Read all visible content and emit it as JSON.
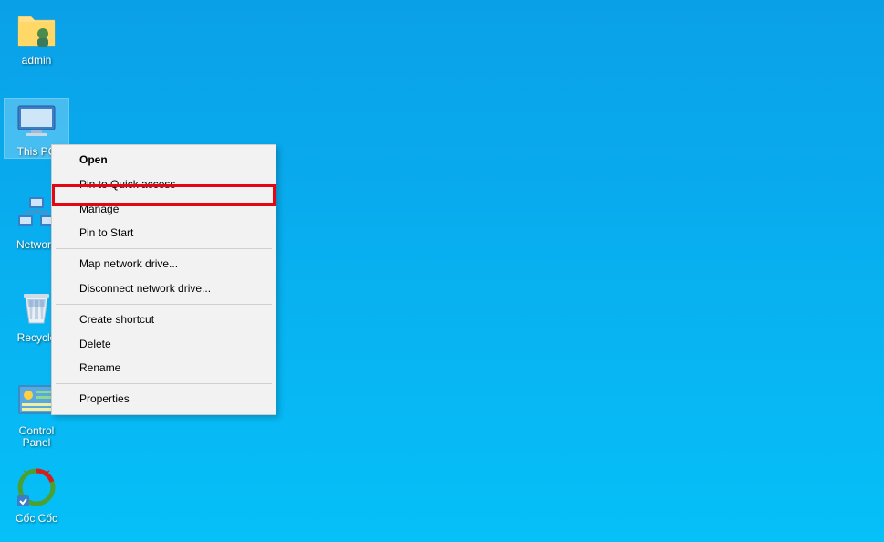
{
  "desktop_icons": [
    {
      "id": "admin",
      "label": "admin"
    },
    {
      "id": "this_pc",
      "label": "This PC"
    },
    {
      "id": "network",
      "label": "Network"
    },
    {
      "id": "recycle",
      "label": "Recycle"
    },
    {
      "id": "control_panel",
      "label": "Control Panel"
    },
    {
      "id": "coc_coc",
      "label": "Cốc Cốc"
    }
  ],
  "context_menu": {
    "open": "Open",
    "pin_quick": "Pin to Quick access",
    "manage": "Manage",
    "pin_start": "Pin to Start",
    "map_drive": "Map network drive...",
    "disconnect_drive": "Disconnect network drive...",
    "create_shortcut": "Create shortcut",
    "delete": "Delete",
    "rename": "Rename",
    "properties": "Properties"
  }
}
